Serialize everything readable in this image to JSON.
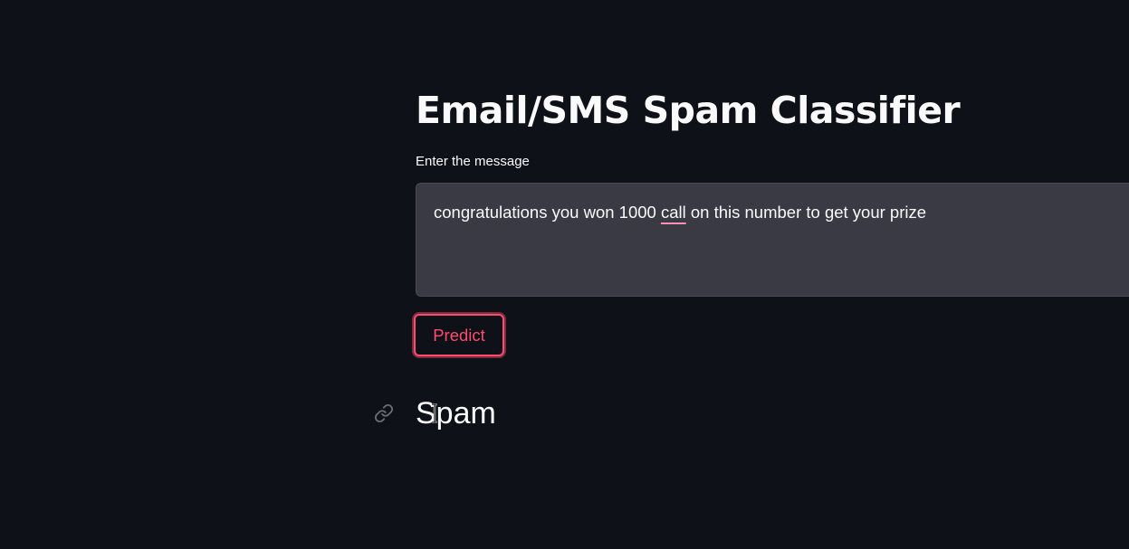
{
  "page": {
    "title": "Email/SMS Spam Classifier"
  },
  "form": {
    "input_label": "Enter the message",
    "message_before": "congratulations you won 1000 ",
    "message_flagged_word": "call",
    "message_after": " on this number to get your prize",
    "predict_label": "Predict"
  },
  "result": {
    "label": "Spam",
    "anchor_icon": "link-icon"
  },
  "colors": {
    "background": "#0e1117",
    "textarea_bg": "#393a44",
    "accent": "#ff4b6e",
    "spellcheck": "#ff8fb5",
    "text": "#fafafa"
  }
}
